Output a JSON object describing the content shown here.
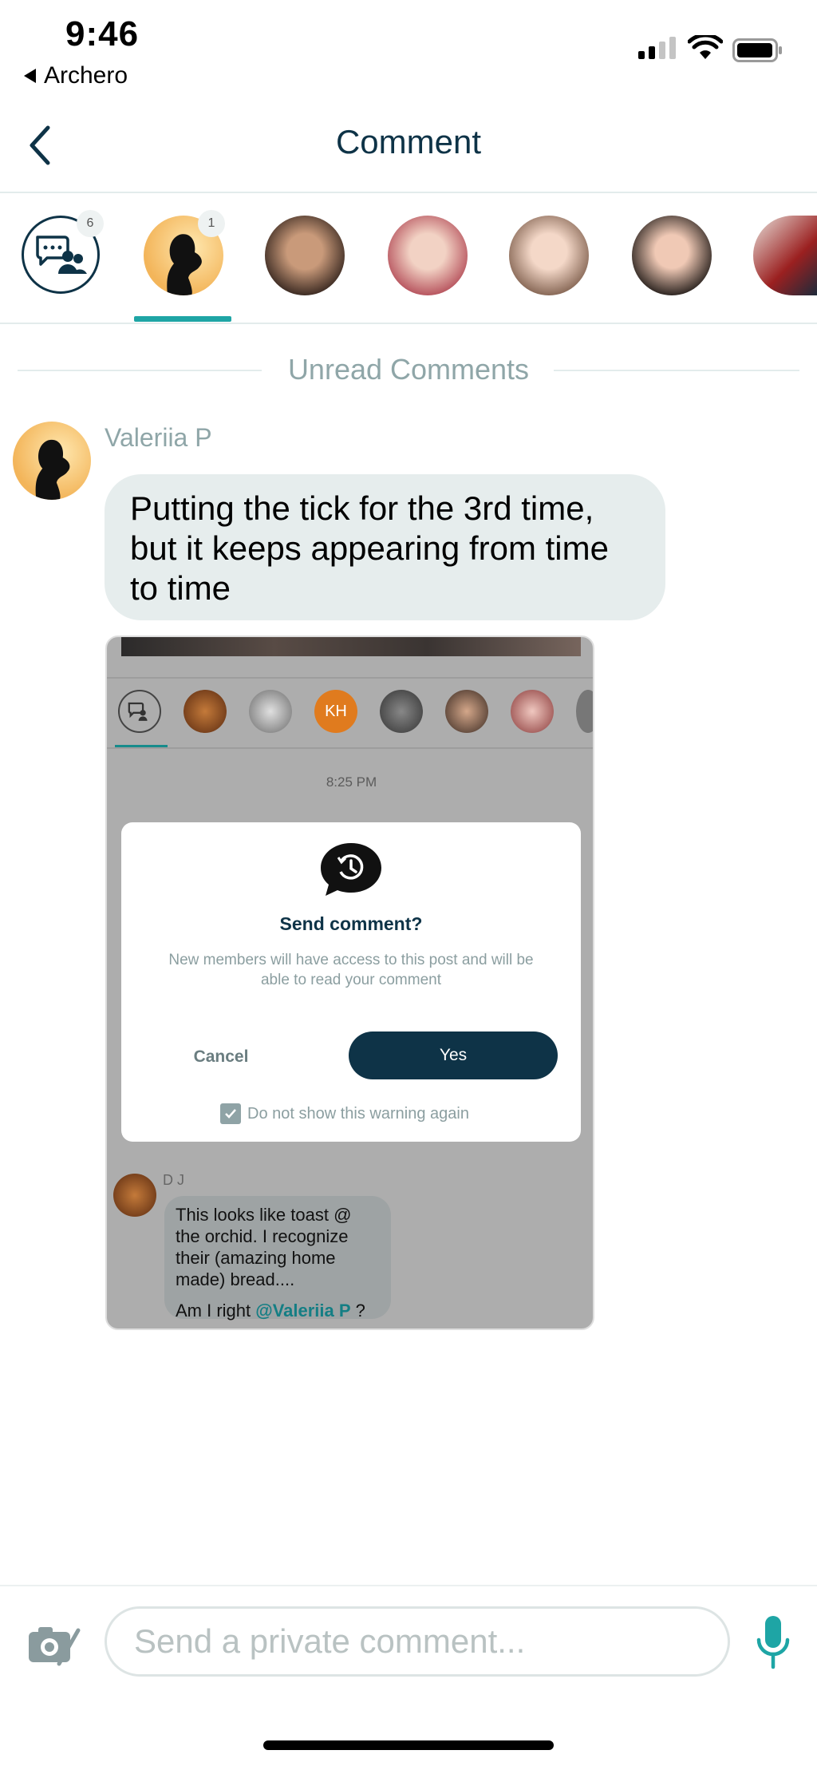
{
  "status_bar": {
    "time": "9:46",
    "back_app": "Archero"
  },
  "nav": {
    "title": "Comment"
  },
  "participants": {
    "group_badge": "6",
    "selected_badge": "1"
  },
  "thread": {
    "divider_label": "Unread Comments",
    "sender": "Valeriia P",
    "message": "Putting the tick for the 3rd time, but it keeps appearing from time to time"
  },
  "attachment": {
    "mini_kh_initials": "KH",
    "time": "8:25 PM",
    "dialog": {
      "title": "Send comment?",
      "body": "New members will have access to this post and will be able to read your comment",
      "cancel": "Cancel",
      "yes": "Yes",
      "checkbox_label": "Do not show this warning again"
    },
    "comment_author": "D J",
    "comment_line1": "This looks like toast @ the orchid. I recognize their (amazing home made) bread....",
    "comment_line2_prefix": "Am I right ",
    "comment_mention": "@Valeriia P",
    "comment_line2_suffix": " ?"
  },
  "composer": {
    "placeholder": "Send a private comment..."
  },
  "colors": {
    "navy": "#0e3347",
    "teal": "#1ea5a5",
    "muted": "#8fa6a8",
    "bubble": "#e6eded"
  }
}
